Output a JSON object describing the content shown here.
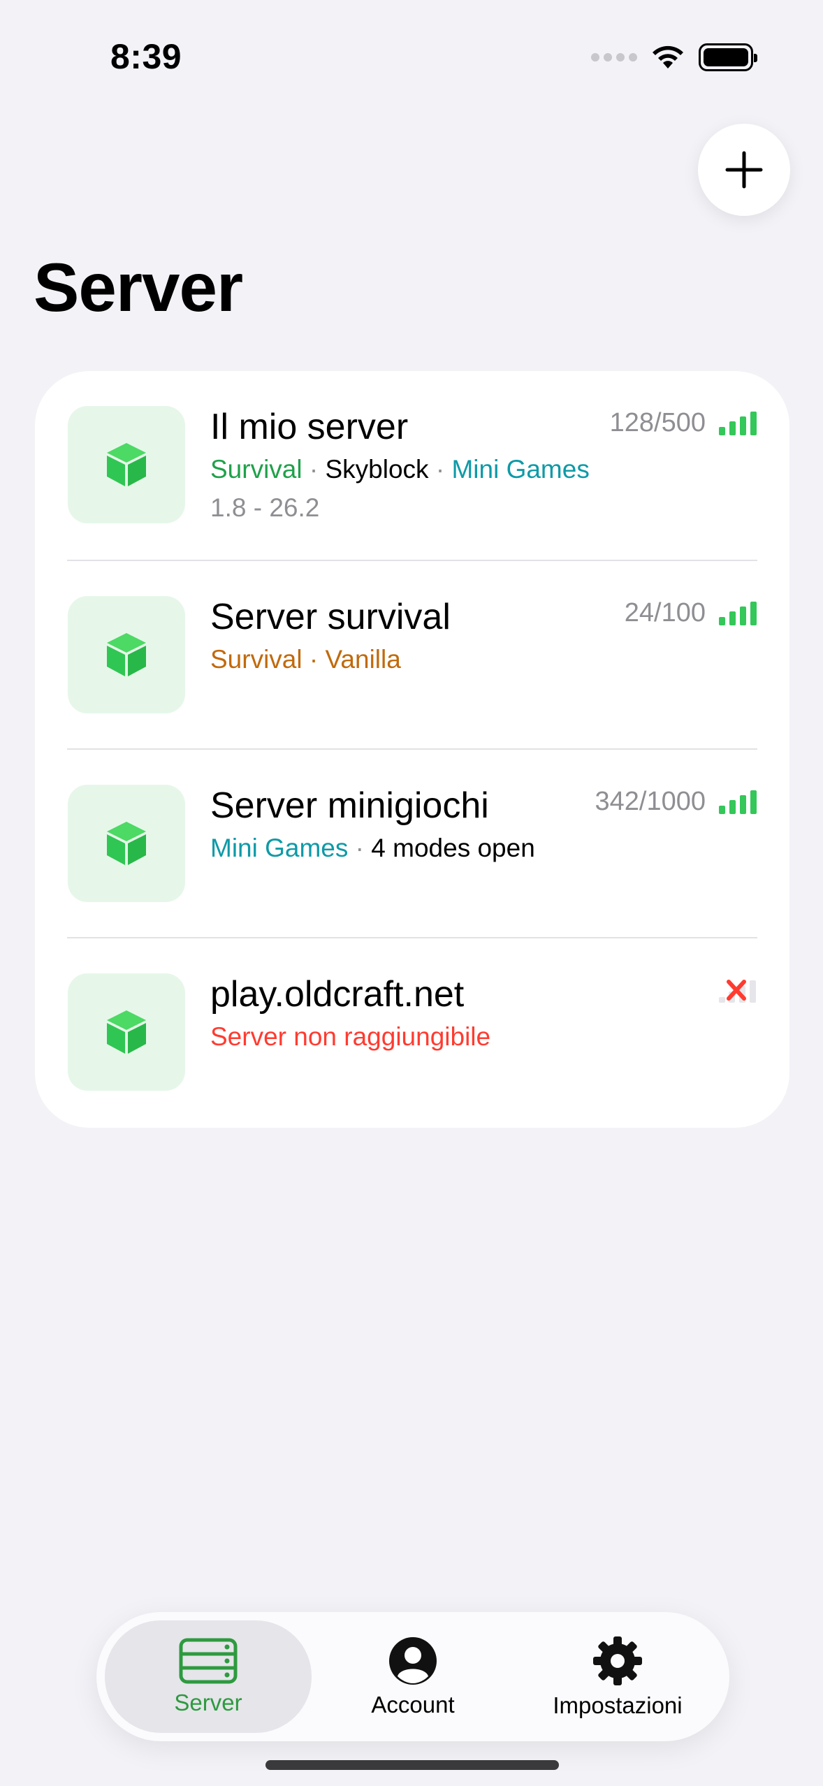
{
  "status": {
    "time": "8:39"
  },
  "header": {
    "title": "Server"
  },
  "servers": [
    {
      "name": "Il mio server",
      "players": "128/500",
      "tags": [
        {
          "text": "Survival",
          "color": "#1fa14a"
        },
        {
          "text": "Skyblock",
          "color": "#000000"
        },
        {
          "text": "Mini Games",
          "color": "#0e9aa7"
        }
      ],
      "version": "1.8 - 26.2",
      "status": "online"
    },
    {
      "name": "Server survival",
      "players": "24/100",
      "tags": [
        {
          "text": "Survival",
          "color": "#c16a0c"
        },
        {
          "text": "Vanilla",
          "color": "#c16a0c"
        }
      ],
      "status": "online"
    },
    {
      "name": "Server minigiochi",
      "players": "342/1000",
      "tags": [
        {
          "text": "Mini Games",
          "color": "#0e9aa7"
        },
        {
          "text": "4 modes open",
          "color": "#000000"
        }
      ],
      "status": "online"
    },
    {
      "name": "play.oldcraft.net",
      "error": "Server non raggiungibile",
      "status": "offline"
    }
  ],
  "tabs": [
    {
      "label": "Server",
      "icon": "server-rack-icon",
      "active": true
    },
    {
      "label": "Account",
      "icon": "person-circle-icon",
      "active": false
    },
    {
      "label": "Impostazioni",
      "icon": "gear-icon",
      "active": false
    }
  ],
  "colors": {
    "accent": "#2e9a3f",
    "online": "#34c759",
    "offline": "#ff3b30",
    "tile": "#e6f7e9"
  }
}
